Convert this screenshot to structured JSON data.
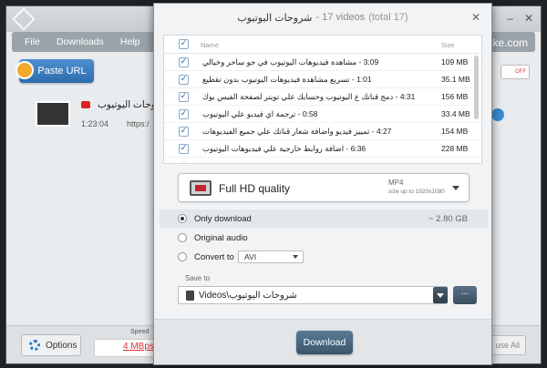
{
  "app": {
    "menu": [
      "File",
      "Downloads",
      "Help"
    ],
    "brand_fragment": "ake.com",
    "paste_url_label": "Paste URL",
    "smart_mode_toggle": "OFF",
    "download_item": {
      "title": "شروحات اليوتيوب",
      "duration": "1:23:04",
      "url_fragment": "https:/"
    },
    "options_label": "Options",
    "speed_label": "Speed",
    "speed_value": "4 MBps",
    "pause_all_label": "use All"
  },
  "dialog": {
    "title": "شروحات اليوتيوب",
    "count": "- 17 videos",
    "total": "(total 17)",
    "close": "✕",
    "list_header": {
      "name": "Name",
      "size": "Size"
    },
    "videos": [
      {
        "name": "3:09 - مشاهدة فيديوهات اليوتيوب في جو ساحر وخيالي",
        "size": "109 MB"
      },
      {
        "name": "1:01 - تسريع مشاهدة فيديوهات اليوتيوب بدون تقطيع",
        "size": "35.1 MB"
      },
      {
        "name": "4:31 - دمج قناتك ع اليوتيوب وحسابك علي تويتر لصفحة الفيس بوك",
        "size": "156 MB"
      },
      {
        "name": "0:58 - ترجمة اي فيديو علي اليوتيوب",
        "size": "33.4 MB"
      },
      {
        "name": "4:27 - تمييز فيديو واضافة شعار قناتك علي جميع الفيديوهات",
        "size": "154 MB"
      },
      {
        "name": "6:36 - اضافة روابط خارجية علي فيديوهات اليوتيوب",
        "size": "228 MB"
      },
      {
        "name": "",
        "size": ""
      }
    ],
    "quality": {
      "name": "Full HD quality",
      "format": "MP4",
      "detail": "size up to 1920x1080"
    },
    "options": {
      "only_download": "Only download",
      "only_download_size": "~ 2.80 GB",
      "original_audio": "Original audio",
      "convert_to": "Convert to",
      "convert_format": "AVI"
    },
    "save_to_label": "Save to",
    "save_path": "Videos\\شروحات اليوتيوب",
    "browse_label": "...",
    "download_label": "Download"
  }
}
